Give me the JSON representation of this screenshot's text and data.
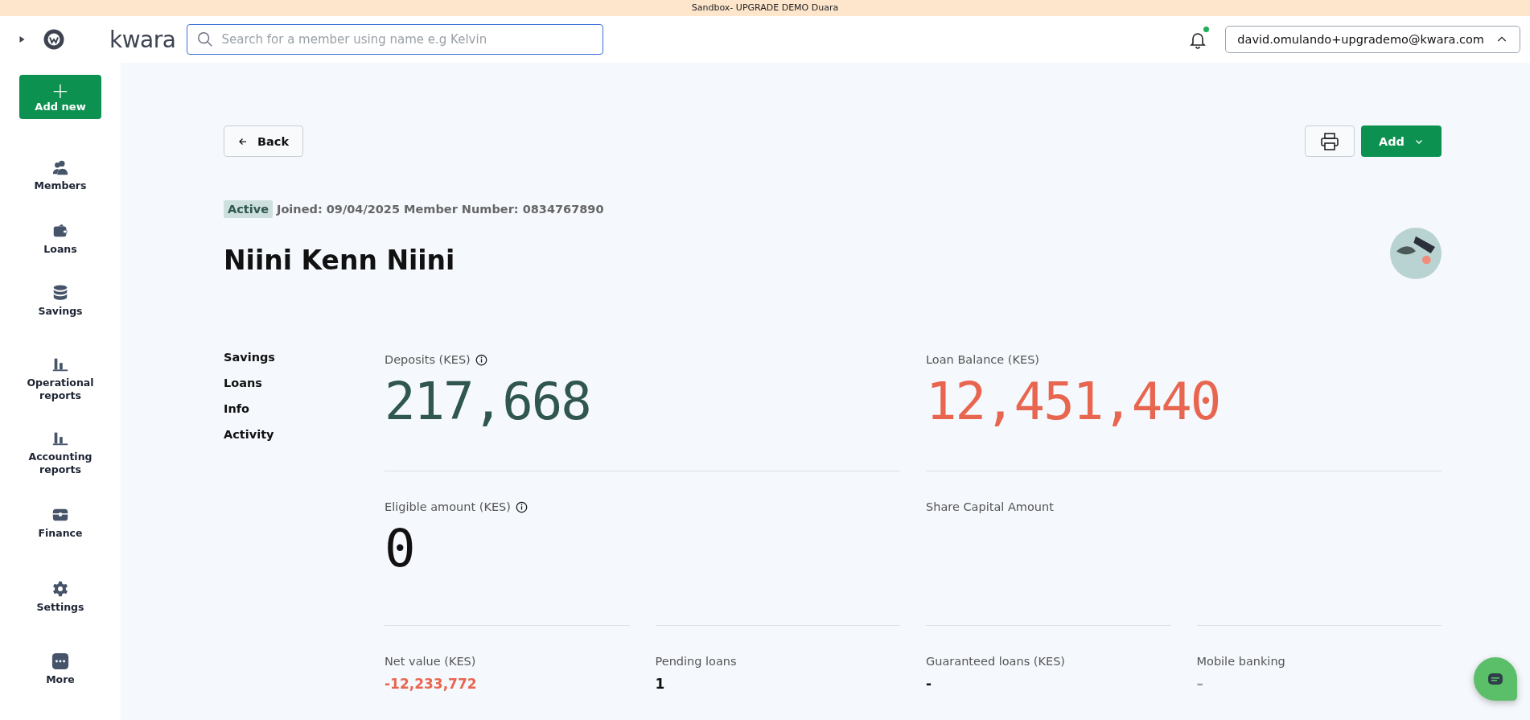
{
  "banner": {
    "text": "Sandbox- UPGRADE DEMO Duara"
  },
  "topbar": {
    "logo": "kwara",
    "search": {
      "placeholder": "Search for a member using name e.g Kelvin"
    },
    "user": "david.omulando+upgrademo@kwara.com"
  },
  "sidebar": {
    "add_button": "+",
    "add_label": "Add new",
    "items": [
      {
        "label": "Members"
      },
      {
        "label": "Loans"
      },
      {
        "label": "Savings"
      },
      {
        "label": "Operational reports"
      },
      {
        "label": "Accounting reports"
      },
      {
        "label": "Finance"
      },
      {
        "label": "Settings"
      },
      {
        "label": "More"
      }
    ]
  },
  "page": {
    "back": "Back",
    "add": "Add",
    "status": "Active",
    "meta": "Joined: 09/04/2025 Member Number: 0834767890",
    "name": "Niini Kenn Niini",
    "section_nav": [
      "Savings",
      "Loans",
      "Info",
      "Activity"
    ],
    "main_stats": [
      {
        "label": "Deposits (KES)",
        "info": true,
        "value": "217,668",
        "color": "#2f5650"
      },
      {
        "label": "Loan Balance (KES)",
        "info": false,
        "value": "12,451,440",
        "color": "#e8664f"
      },
      {
        "label": "Eligible amount (KES)",
        "info": true,
        "value": "0",
        "color": "#111111"
      },
      {
        "label": "Share Capital Amount",
        "info": false
      }
    ],
    "small_stats": [
      {
        "label": "Net value (KES)",
        "value": "-12,233,772",
        "color": "#e8664f"
      },
      {
        "label": "Pending loans",
        "value": "1",
        "color": "#111111"
      },
      {
        "label": "Guaranteed loans (KES)",
        "value": "-",
        "color": "#111111"
      },
      {
        "label": "Mobile banking",
        "value": "–",
        "color": "#9aa0a6"
      }
    ]
  }
}
